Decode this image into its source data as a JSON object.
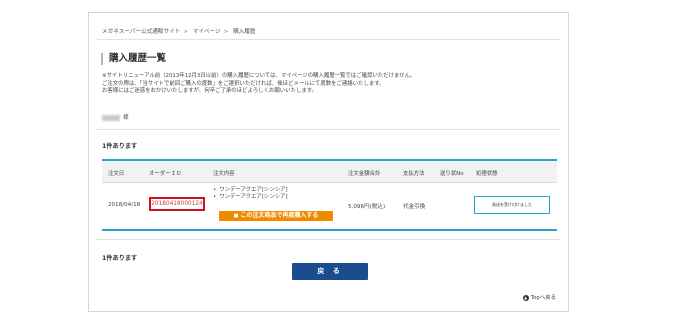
{
  "breadcrumb": {
    "items": [
      "メガネスーパー公式通販サイト",
      "マイページ",
      "購入履歴"
    ],
    "separator": ">"
  },
  "page_title": "購入履歴一覧",
  "notice": {
    "line1": "※サイトリニューアル前（2013年12月3日以前）の購入履歴については、マイページの購入履歴一覧ではご確認いただけません。",
    "line2": "ご注文の際は、「当サイトで前回ご購入の度数」をご選択いただければ、後ほどメールにて度数をご連絡いたします。",
    "line3": "お客様にはご迷惑をおかけいたしますが、何卒ご了承のほどよろしくお願いいたします。"
  },
  "user": {
    "suffix": "様"
  },
  "count_text": "1件あります",
  "table": {
    "headers": [
      "注文日",
      "オーダーＩＤ",
      "注文内容",
      "注文金額合計",
      "支払方法",
      "送り状No",
      "処理状態"
    ],
    "rows": [
      {
        "date": "2018/04/18",
        "order_id": "20180418000124",
        "products": [
          "ワンデーアクエア[シンシア]",
          "ワンデーアクエア[シンシア]"
        ],
        "rebuy_label": "この注文商品で再度購入する",
        "total": "5,096円(税込)",
        "payment": "代金引換",
        "tracking": "",
        "status": "発送を受け付けました"
      }
    ]
  },
  "back_label": "戻 る",
  "to_top_label": "Topへ戻る",
  "colors": {
    "accent": "#2aa3c7",
    "back_button": "#1b4c8e",
    "rebuy_button": "#f08a00",
    "highlight": "#d0121b"
  }
}
